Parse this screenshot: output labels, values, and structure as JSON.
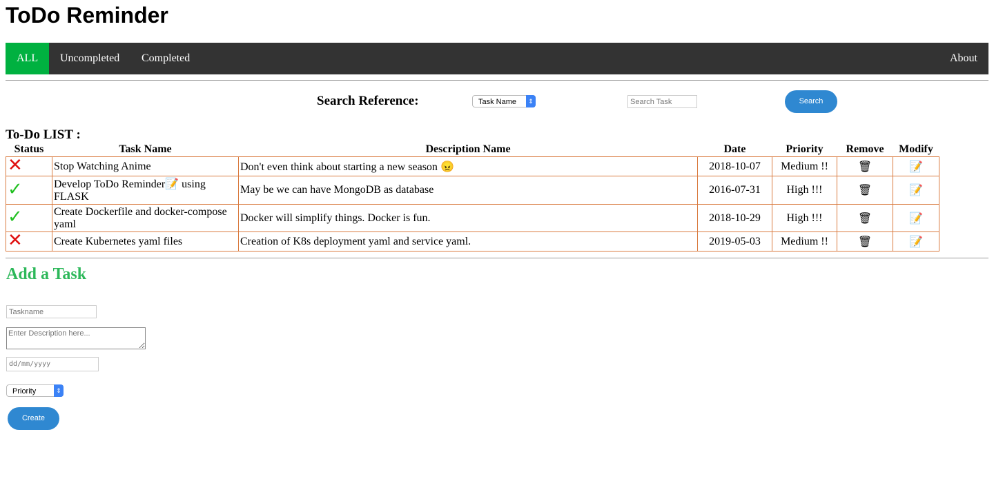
{
  "title": "ToDo Reminder",
  "nav": {
    "all": "ALL",
    "uncompleted": "Uncompleted",
    "completed": "Completed",
    "about": "About"
  },
  "search": {
    "label": "Search Reference:",
    "reference": "Task Name",
    "placeholder": "Search Task",
    "button": "Search"
  },
  "list": {
    "heading": "To-Do LIST :",
    "columns": [
      "Status",
      "Task Name",
      "Description Name",
      "Date",
      "Priority",
      "Remove",
      "Modify"
    ],
    "rows": [
      {
        "status": "uncompleted",
        "status_glyph": "✕",
        "task": "Stop Watching Anime",
        "desc": "Don't even think about starting a new season",
        "desc_emoji": "😠",
        "date": "2018-10-07",
        "priority": "Medium !!"
      },
      {
        "status": "completed",
        "status_glyph": "✓",
        "task": "Develop ToDo Reminder",
        "task_emoji": "📝",
        "task_rest": " using FLASK",
        "desc": "May be we can have MongoDB as database",
        "date": "2016-07-31",
        "priority": "High !!!"
      },
      {
        "status": "completed",
        "status_glyph": "✓",
        "task": "Create Dockerfile and docker-compose yaml",
        "desc": "Docker will simplify things. Docker is fun.",
        "date": "2018-10-29",
        "priority": "High !!!"
      },
      {
        "status": "uncompleted",
        "status_glyph": "✕",
        "task": "Create Kubernetes yaml files",
        "desc": "Creation of K8s deployment yaml and service yaml.",
        "date": "2019-05-03",
        "priority": "Medium !!"
      }
    ],
    "remove_icon": "🗑",
    "modify_icon": "📝"
  },
  "add": {
    "heading": "Add a Task",
    "taskname_placeholder": "Taskname",
    "desc_placeholder": "Enter Description here...",
    "date_placeholder": "dd/mm/yyyy",
    "priority": "Priority",
    "button": "Create"
  },
  "colors": {
    "nav": "#333333",
    "active": "#00b140",
    "accent": "#2f88d1",
    "heading_green": "#2db85a",
    "border": "#d9793d"
  }
}
